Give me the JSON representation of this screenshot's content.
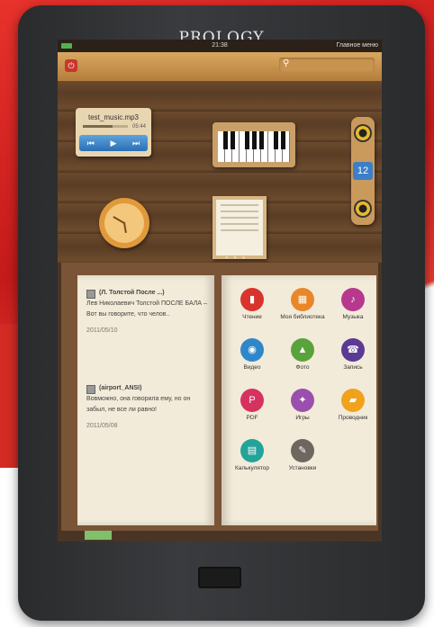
{
  "brand": "PROLOGY",
  "statusbar": {
    "time": "21:38",
    "home_label": "Главное меню"
  },
  "music": {
    "title": "test_music.mp3",
    "time": "05:44",
    "progress": 0.65,
    "prev": "⏮",
    "play": "▶",
    "next": "⏭"
  },
  "speaker": {
    "number": "12"
  },
  "recent": [
    {
      "title": "(Л. Толстой После ...)",
      "text": "Лев Николаевич Толстой ПОСЛЕ БАЛА – Вот вы говорите, что челов..",
      "date": "2011/05/10"
    },
    {
      "title": "(airport_ANSI)",
      "text": "Вовможно, она говорила ему, но он забыл, не все ли равно!",
      "date": "2011/05/08"
    }
  ],
  "apps": [
    {
      "label": "Чтение",
      "icon": "read-icon",
      "color": "#d9342c",
      "glyph": "▮"
    },
    {
      "label": "Моя библиотека",
      "icon": "library-icon",
      "color": "#e8872a",
      "glyph": "▦"
    },
    {
      "label": "Музыка",
      "icon": "music-icon",
      "color": "#b6398e",
      "glyph": "♪"
    },
    {
      "label": "Видео",
      "icon": "video-icon",
      "color": "#2f87c9",
      "glyph": "◉"
    },
    {
      "label": "Фото",
      "icon": "photo-icon",
      "color": "#5aa33c",
      "glyph": "▲"
    },
    {
      "label": "Запись",
      "icon": "record-icon",
      "color": "#5b3a93",
      "glyph": "☎"
    },
    {
      "label": "PDF",
      "icon": "pdf-icon",
      "color": "#d6325f",
      "glyph": "P"
    },
    {
      "label": "Игры",
      "icon": "games-icon",
      "color": "#9a4fae",
      "glyph": "✦"
    },
    {
      "label": "Проводник",
      "icon": "explorer-icon",
      "color": "#f0a21d",
      "glyph": "▰"
    },
    {
      "label": "Калькулятор",
      "icon": "calculator-icon",
      "color": "#23a39a",
      "glyph": "▤"
    },
    {
      "label": "Установки",
      "icon": "settings-icon",
      "color": "#6d6760",
      "glyph": "✎"
    }
  ]
}
